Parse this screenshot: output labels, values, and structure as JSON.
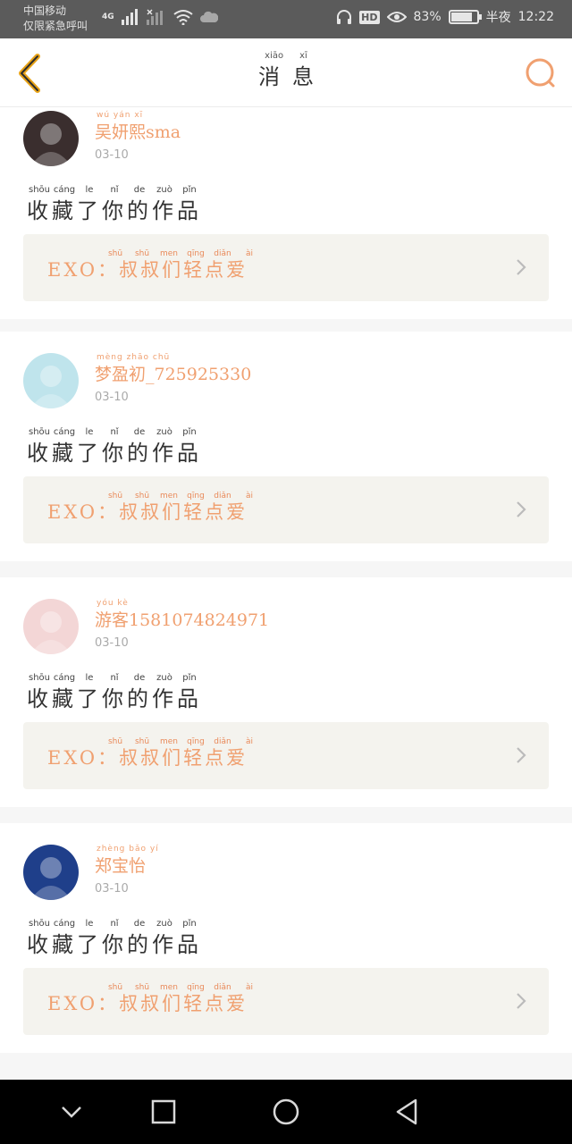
{
  "status_bar": {
    "carrier_line1": "中国移动",
    "carrier_line2": "仅限紧急呼叫",
    "network": "4G",
    "battery_percent": "83%",
    "time_prefix": "半夜",
    "time": "12:22",
    "battery_level": 0.83
  },
  "header": {
    "title": "消息",
    "title_pinyin": [
      "xiāo",
      "xī"
    ]
  },
  "notifications": [
    {
      "username": "吴妍熙sma",
      "username_pinyin": "wú yán xī",
      "date": "03-10",
      "action": "收藏了你的作品",
      "action_pinyin": [
        "shōu",
        "cáng",
        "le",
        "nǐ",
        "de",
        "zuò",
        "pǐn"
      ],
      "work_title": "EXO：叔叔们轻点爱",
      "work_pinyin": [
        "shū",
        "shū",
        "men",
        "qīng",
        "diǎn",
        "ài"
      ],
      "avatar_color": "#3a2e2e"
    },
    {
      "username": "梦盈初_725925330",
      "username_pinyin": "mèng zhāo chū",
      "date": "03-10",
      "action": "收藏了你的作品",
      "action_pinyin": [
        "shōu",
        "cáng",
        "le",
        "nǐ",
        "de",
        "zuò",
        "pǐn"
      ],
      "work_title": "EXO：叔叔们轻点爱",
      "work_pinyin": [
        "shū",
        "shū",
        "men",
        "qīng",
        "diǎn",
        "ài"
      ],
      "avatar_color": "#bfe4ec"
    },
    {
      "username": "游客1581074824971",
      "username_pinyin": "yóu kè",
      "date": "03-10",
      "action": "收藏了你的作品",
      "action_pinyin": [
        "shōu",
        "cáng",
        "le",
        "nǐ",
        "de",
        "zuò",
        "pǐn"
      ],
      "work_title": "EXO：叔叔们轻点爱",
      "work_pinyin": [
        "shū",
        "shū",
        "men",
        "qīng",
        "diǎn",
        "ài"
      ],
      "avatar_color": "#f3d6d6"
    },
    {
      "username": "郑宝怡",
      "username_pinyin": "zhèng bǎo yí",
      "date": "03-10",
      "action": "收藏了你的作品",
      "action_pinyin": [
        "shōu",
        "cáng",
        "le",
        "nǐ",
        "de",
        "zuò",
        "pǐn"
      ],
      "work_title": "EXO：叔叔们轻点爱",
      "work_pinyin": [
        "shū",
        "shū",
        "men",
        "qīng",
        "diǎn",
        "ài"
      ],
      "avatar_color": "#1f3f8a"
    }
  ],
  "icons": {
    "back": "back-arrow-icon",
    "search": "search-icon",
    "chevron": "chevron-right-icon",
    "nav_down": "chevron-down-icon",
    "nav_recent": "square-icon",
    "nav_home": "circle-icon",
    "nav_back": "triangle-back-icon"
  },
  "colors": {
    "accent": "#f0a070",
    "back_icon": "#e8a317",
    "work_bg": "#f4f3ee"
  }
}
